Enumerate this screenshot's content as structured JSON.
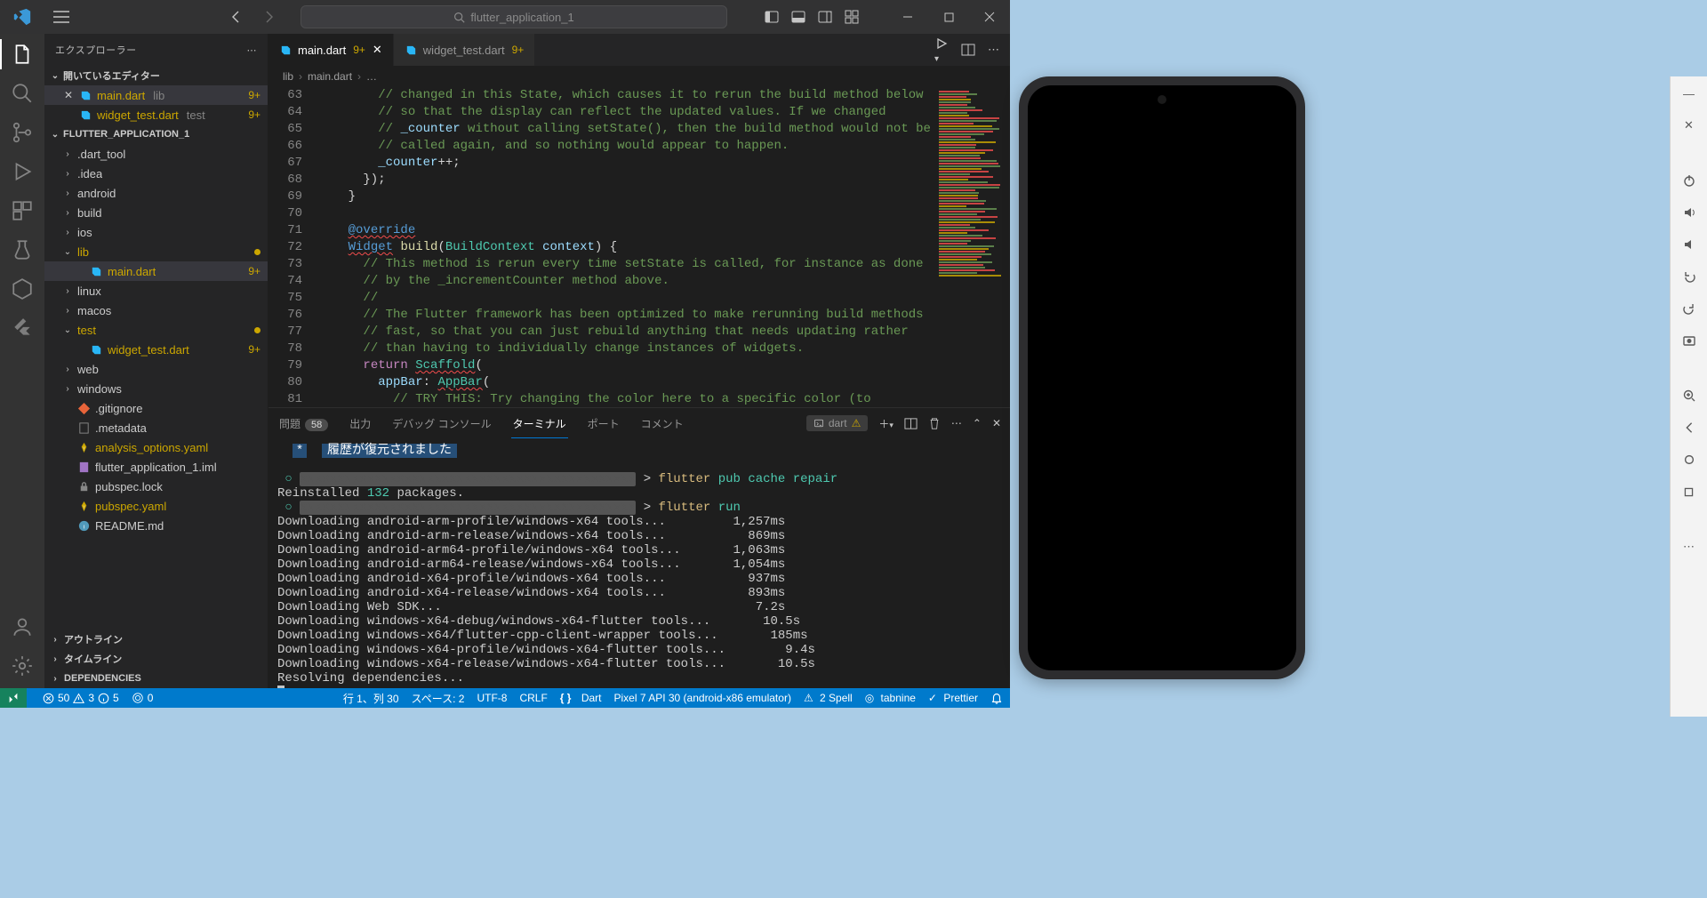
{
  "titlebar": {
    "project": "flutter_application_1"
  },
  "sidebar": {
    "title": "エクスプローラー",
    "openEditorsTitle": "開いているエディター",
    "openEditors": [
      {
        "name": "main.dart",
        "dir": "lib",
        "badge": "9+",
        "close": true
      },
      {
        "name": "widget_test.dart",
        "dir": "test",
        "badge": "9+",
        "close": false
      }
    ],
    "projectTitle": "FLUTTER_APPLICATION_1",
    "tree": [
      {
        "indent": 1,
        "chev": "›",
        "label": ".dart_tool",
        "kind": "folder"
      },
      {
        "indent": 1,
        "chev": "›",
        "label": ".idea",
        "kind": "folder"
      },
      {
        "indent": 1,
        "chev": "›",
        "label": "android",
        "kind": "folder"
      },
      {
        "indent": 1,
        "chev": "›",
        "label": "build",
        "kind": "folder"
      },
      {
        "indent": 1,
        "chev": "›",
        "label": "ios",
        "kind": "folder"
      },
      {
        "indent": 1,
        "chev": "⌄",
        "label": "lib",
        "kind": "folder",
        "mod": true,
        "dot": true
      },
      {
        "indent": 2,
        "chev": "",
        "label": "main.dart",
        "kind": "dart",
        "mod": true,
        "badge": "9+",
        "selected": true
      },
      {
        "indent": 1,
        "chev": "›",
        "label": "linux",
        "kind": "folder"
      },
      {
        "indent": 1,
        "chev": "›",
        "label": "macos",
        "kind": "folder"
      },
      {
        "indent": 1,
        "chev": "⌄",
        "label": "test",
        "kind": "folder",
        "mod": true,
        "dot": true
      },
      {
        "indent": 2,
        "chev": "",
        "label": "widget_test.dart",
        "kind": "dart",
        "mod": true,
        "badge": "9+"
      },
      {
        "indent": 1,
        "chev": "›",
        "label": "web",
        "kind": "folder"
      },
      {
        "indent": 1,
        "chev": "›",
        "label": "windows",
        "kind": "folder"
      },
      {
        "indent": 1,
        "chev": "",
        "label": ".gitignore",
        "kind": "git"
      },
      {
        "indent": 1,
        "chev": "",
        "label": ".metadata",
        "kind": "file"
      },
      {
        "indent": 1,
        "chev": "",
        "label": "analysis_options.yaml",
        "kind": "yaml",
        "warn": true
      },
      {
        "indent": 1,
        "chev": "",
        "label": "flutter_application_1.iml",
        "kind": "iml"
      },
      {
        "indent": 1,
        "chev": "",
        "label": "pubspec.lock",
        "kind": "lock"
      },
      {
        "indent": 1,
        "chev": "",
        "label": "pubspec.yaml",
        "kind": "yaml",
        "warn": true
      },
      {
        "indent": 1,
        "chev": "",
        "label": "README.md",
        "kind": "md"
      }
    ],
    "outline": "アウトライン",
    "timeline": "タイムライン",
    "dependencies": "DEPENDENCIES"
  },
  "tabs": [
    {
      "name": "main.dart",
      "badge": "9+",
      "active": true,
      "closeable": true
    },
    {
      "name": "widget_test.dart",
      "badge": "9+",
      "active": false,
      "closeable": false
    }
  ],
  "breadcrumb": [
    "lib",
    "main.dart",
    "…"
  ],
  "code": {
    "start": 63,
    "lines": [
      "        // changed in this State, which causes it to rerun the build method below",
      "        // so that the display can reflect the updated values. If we changed",
      "        // _counter without calling setState(), then the build method would not be",
      "        // called again, and so nothing would appear to happen.",
      "        _counter++;",
      "      });",
      "    }",
      "",
      "    @override",
      "    Widget build(BuildContext context) {",
      "      // This method is rerun every time setState is called, for instance as done",
      "      // by the _incrementCounter method above.",
      "      //",
      "      // The Flutter framework has been optimized to make rerunning build methods",
      "      // fast, so that you can just rebuild anything that needs updating rather",
      "      // than having to individually change instances of widgets.",
      "      return Scaffold(",
      "        appBar: AppBar(",
      "          // TRY THIS: Try changing the color here to a specific color (to"
    ]
  },
  "panel": {
    "tabs": {
      "problems": "問題",
      "problemsCount": "58",
      "output": "出力",
      "debugConsole": "デバッグ コンソール",
      "terminal": "ターミナル",
      "ports": "ポート",
      "comments": "コメント"
    },
    "shell": "dart",
    "historyRestored": "履歴が復元されました",
    "terminalLines": [
      {
        "type": "prompt",
        "cmd": "flutter pub cache repair"
      },
      {
        "type": "out",
        "text": "Reinstalled ",
        "num": "132",
        "text2": " packages."
      },
      {
        "type": "prompt",
        "cmd": "flutter run"
      },
      {
        "type": "dl",
        "text": "Downloading android-arm-profile/windows-x64 tools...",
        "time": "1,257ms"
      },
      {
        "type": "dl",
        "text": "Downloading android-arm-release/windows-x64 tools...",
        "time": "869ms"
      },
      {
        "type": "dl",
        "text": "Downloading android-arm64-profile/windows-x64 tools...",
        "time": "1,063ms"
      },
      {
        "type": "dl",
        "text": "Downloading android-arm64-release/windows-x64 tools...",
        "time": "1,054ms"
      },
      {
        "type": "dl",
        "text": "Downloading android-x64-profile/windows-x64 tools...",
        "time": "937ms"
      },
      {
        "type": "dl",
        "text": "Downloading android-x64-release/windows-x64 tools...",
        "time": "893ms"
      },
      {
        "type": "dl",
        "text": "Downloading Web SDK...",
        "time": "7.2s"
      },
      {
        "type": "dl",
        "text": "Downloading windows-x64-debug/windows-x64-flutter tools...",
        "time": "10.5s"
      },
      {
        "type": "dl",
        "text": "Downloading windows-x64/flutter-cpp-client-wrapper tools...",
        "time": "185ms"
      },
      {
        "type": "dl",
        "text": "Downloading windows-x64-profile/windows-x64-flutter tools...",
        "time": "9.4s"
      },
      {
        "type": "dl",
        "text": "Downloading windows-x64-release/windows-x64-flutter tools...",
        "time": "10.5s"
      },
      {
        "type": "out",
        "text": "Resolving dependencies..."
      }
    ]
  },
  "status": {
    "errors": "50",
    "warnings": "3",
    "infos": "5",
    "ports": "0",
    "lineCol": "行 1、列 30",
    "spaces": "スペース: 2",
    "encoding": "UTF-8",
    "eol": "CRLF",
    "lang": "Dart",
    "device": "Pixel 7 API 30 (android-x86 emulator)",
    "spell": "2 Spell",
    "tabnine": "tabnine",
    "prettier": "Prettier"
  }
}
